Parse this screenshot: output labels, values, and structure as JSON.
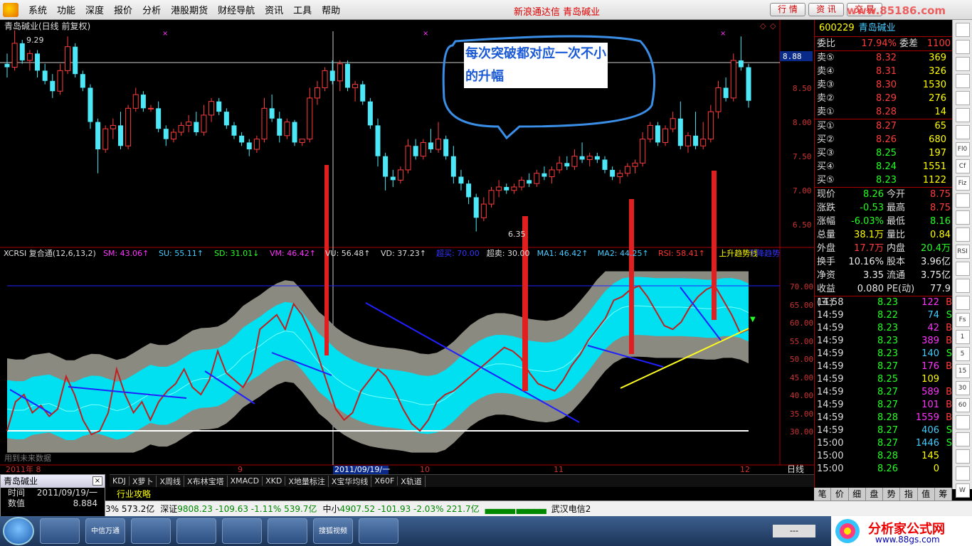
{
  "menu": {
    "items": [
      "系统",
      "功能",
      "深度",
      "报价",
      "分析",
      "港股期货",
      "财经导航",
      "资讯",
      "工具",
      "帮助"
    ],
    "app_title": "新浪通达信  青岛碱业",
    "buttons": [
      "行 情",
      "资 讯",
      "交 易"
    ],
    "watermark": "www.85186.com"
  },
  "chart": {
    "title": "青岛碱业(日线 前复权)",
    "high_label": "9.29",
    "low_label": "6.35",
    "current_price_tag": "8.88",
    "price_axis": [
      "8.50",
      "8.00",
      "7.50",
      "7.00",
      "6.50"
    ],
    "indicator_axis": [
      "70.00",
      "65.00",
      "60.00",
      "55.00",
      "50.00",
      "45.00",
      "40.00",
      "35.00",
      "30.00"
    ],
    "indicator_header": {
      "name": "XCRSI 复合通(12,6,13,2)",
      "items": [
        {
          "label": "SM: 43.06↑",
          "color": "#f3f"
        },
        {
          "label": "SU: 55.11↑",
          "color": "#4cf"
        },
        {
          "label": "SD: 31.01↓",
          "color": "#2f2"
        },
        {
          "label": "VM: 46.42↑",
          "color": "#f3f"
        },
        {
          "label": "VU: 56.48↑",
          "color": "#ddd"
        },
        {
          "label": "VD: 37.23↑",
          "color": "#ddd"
        },
        {
          "label": "超买: 70.00",
          "color": "#33f"
        },
        {
          "label": "超卖: 30.00",
          "color": "#ddd"
        },
        {
          "label": "MA1: 46.42↑",
          "color": "#4cf"
        },
        {
          "label": "MA2: 44.25↑",
          "color": "#4cf"
        },
        {
          "label": "RSI: 58.41↑",
          "color": "#f33"
        },
        {
          "label": "上升趋势线",
          "color": "#ff0"
        },
        {
          "label": "下降趋势",
          "color": "#33f"
        }
      ]
    },
    "future_data_note": "用到未来数据",
    "date_labels": {
      "m9": "9",
      "selected": "2011/09/19/一",
      "m10": "10",
      "m11": "11",
      "m12": "12",
      "left": "2011年 8",
      "period": "日线"
    },
    "callout": "每次突破都对应一次不小的升幅"
  },
  "quote": {
    "code": "600229",
    "name": "青岛碱业",
    "weibi_label": "委比",
    "weibi": "17.94%",
    "weicha_label": "委差",
    "weicha": "1100",
    "sells": [
      {
        "label": "卖⑤",
        "price": "8.32",
        "vol": "369"
      },
      {
        "label": "卖④",
        "price": "8.31",
        "vol": "326"
      },
      {
        "label": "卖③",
        "price": "8.30",
        "vol": "1530"
      },
      {
        "label": "卖②",
        "price": "8.29",
        "vol": "276"
      },
      {
        "label": "卖①",
        "price": "8.28",
        "vol": "14"
      }
    ],
    "buys": [
      {
        "label": "买①",
        "price": "8.27",
        "vol": "65"
      },
      {
        "label": "买②",
        "price": "8.26",
        "vol": "680"
      },
      {
        "label": "买③",
        "price": "8.25",
        "vol": "197"
      },
      {
        "label": "买④",
        "price": "8.24",
        "vol": "1551"
      },
      {
        "label": "买⑤",
        "price": "8.23",
        "vol": "1122"
      }
    ],
    "info": [
      {
        "a": "现价",
        "b": "8.26",
        "bc": "green",
        "c": "今开",
        "d": "8.75",
        "dc": "red"
      },
      {
        "a": "涨跌",
        "b": "-0.53",
        "bc": "green",
        "c": "最高",
        "d": "8.75",
        "dc": "red"
      },
      {
        "a": "涨幅",
        "b": "-6.03%",
        "bc": "green",
        "c": "最低",
        "d": "8.16",
        "dc": "green"
      },
      {
        "a": "总量",
        "b": "38.1万",
        "bc": "yellow",
        "c": "量比",
        "d": "0.84",
        "dc": "yellow"
      },
      {
        "a": "外盘",
        "b": "17.7万",
        "bc": "red",
        "c": "内盘",
        "d": "20.4万",
        "dc": "green"
      },
      {
        "a": "换手",
        "b": "10.16%",
        "bc": "white",
        "c": "股本",
        "d": "3.96亿",
        "dc": "white"
      },
      {
        "a": "净资",
        "b": "3.35",
        "bc": "white",
        "c": "流通",
        "d": "3.75亿",
        "dc": "white"
      },
      {
        "a": "收益(三)",
        "b": "0.080",
        "bc": "white",
        "c": "PE(动)",
        "d": "77.9",
        "dc": "white"
      }
    ],
    "ticks": [
      {
        "t": "14:58",
        "p": "8.23",
        "v": "122",
        "s": "B"
      },
      {
        "t": "14:59",
        "p": "8.22",
        "v": "74",
        "s": "S"
      },
      {
        "t": "14:59",
        "p": "8.23",
        "v": "42",
        "s": "B"
      },
      {
        "t": "14:59",
        "p": "8.23",
        "v": "389",
        "s": "B"
      },
      {
        "t": "14:59",
        "p": "8.23",
        "v": "140",
        "s": "S"
      },
      {
        "t": "14:59",
        "p": "8.27",
        "v": "176",
        "s": "B"
      },
      {
        "t": "14:59",
        "p": "8.25",
        "v": "109",
        "s": ""
      },
      {
        "t": "14:59",
        "p": "8.27",
        "v": "589",
        "s": "B"
      },
      {
        "t": "14:59",
        "p": "8.27",
        "v": "101",
        "s": "B"
      },
      {
        "t": "14:59",
        "p": "8.28",
        "v": "1559",
        "s": "B"
      },
      {
        "t": "14:59",
        "p": "8.27",
        "v": "406",
        "s": "S"
      },
      {
        "t": "15:00",
        "p": "8.27",
        "v": "1446",
        "s": "S"
      },
      {
        "t": "15:00",
        "p": "8.28",
        "v": "145",
        "s": ""
      },
      {
        "t": "15:00",
        "p": "8.26",
        "v": "0",
        "s": ""
      }
    ]
  },
  "toolstrip": [
    "",
    "",
    "",
    "",
    "",
    "",
    "",
    "Fl0",
    "Cf",
    "Fiz",
    "",
    "",
    "",
    "RSI",
    "",
    "",
    "",
    "Fs",
    "1",
    "5",
    "15",
    "30",
    "60",
    "",
    "",
    "",
    "",
    "W"
  ],
  "tabbar": [
    "KDJ",
    "X萝卜",
    "X周线",
    "X布林宝塔",
    "XMACD",
    "XKD",
    "X地量标注",
    "X宝华均线",
    "X60F",
    "X轨道"
  ],
  "subbar": "行业攻略",
  "panel_tabs": [
    "笔",
    "价",
    "细",
    "盘",
    "势",
    "指",
    "值",
    "筹"
  ],
  "mini": {
    "title": "青岛碱业",
    "rows": [
      {
        "k": "时间",
        "v": "2011/09/19/一"
      },
      {
        "k": "数值",
        "v": "8.884"
      }
    ]
  },
  "status": {
    "partial": "3%  573.2亿",
    "sz_label": "深证",
    "sz": "9808.23  -109.63  -1.11%  539.7亿",
    "zx_label": "中小",
    "zx": "4907.52  -101.93  -2.03%  221.7亿",
    "news": "武汉电信2"
  },
  "taskbar": {
    "buttons": [
      "中信万通",
      "",
      "",
      "",
      "",
      "搜狐视频",
      ""
    ],
    "brand_title": "分析家公式网",
    "brand_url": "www.88gs.com",
    "clock": "---"
  },
  "colors": {
    "up": "#ff3c3c",
    "down": "#4de8f8",
    "cyan_band": "#00e0f0",
    "gray_band": "#8a8a80",
    "rsi": "#c02020",
    "down_trend": "#2020ff",
    "up_trend": "#ffff20"
  },
  "chart_data": {
    "type": "candlestick",
    "price_range": [
      6.2,
      9.4
    ],
    "candles": [
      [
        8.8,
        8.95,
        8.6,
        8.75
      ],
      [
        8.75,
        9.29,
        8.7,
        9.1
      ],
      [
        9.1,
        9.15,
        8.8,
        8.85
      ],
      [
        8.85,
        9.0,
        8.7,
        8.95
      ],
      [
        8.95,
        9.0,
        8.6,
        8.7
      ],
      [
        8.7,
        8.8,
        8.5,
        8.55
      ],
      [
        8.55,
        8.65,
        8.3,
        8.4
      ],
      [
        8.4,
        8.8,
        8.35,
        8.7
      ],
      [
        8.7,
        9.2,
        8.65,
        9.05
      ],
      [
        9.05,
        9.1,
        8.6,
        8.65
      ],
      [
        8.65,
        8.7,
        8.4,
        8.45
      ],
      [
        8.45,
        8.5,
        7.85,
        7.95
      ],
      [
        7.95,
        8.0,
        7.2,
        7.55
      ],
      [
        7.55,
        7.9,
        7.5,
        7.85
      ],
      [
        7.85,
        8.0,
        7.7,
        7.9
      ],
      [
        7.9,
        8.1,
        7.55,
        7.6
      ],
      [
        7.6,
        8.2,
        7.55,
        8.15
      ],
      [
        8.15,
        8.45,
        8.1,
        8.35
      ],
      [
        8.35,
        8.4,
        8.1,
        8.15
      ],
      [
        8.15,
        8.2,
        8.1,
        8.15
      ],
      [
        8.15,
        8.25,
        7.8,
        7.85
      ],
      [
        7.85,
        7.9,
        7.6,
        7.7
      ],
      [
        7.7,
        7.85,
        7.65,
        7.8
      ],
      [
        7.8,
        7.95,
        7.75,
        7.9
      ],
      [
        7.9,
        8.05,
        7.8,
        7.95
      ],
      [
        7.95,
        8.1,
        7.75,
        7.8
      ],
      [
        7.8,
        8.2,
        7.75,
        8.05
      ],
      [
        8.05,
        8.3,
        7.95,
        8.25
      ],
      [
        8.25,
        8.3,
        8.05,
        8.1
      ],
      [
        8.1,
        8.15,
        7.85,
        7.9
      ],
      [
        7.9,
        7.95,
        7.7,
        7.75
      ],
      [
        7.75,
        7.8,
        7.6,
        7.65
      ],
      [
        7.65,
        7.7,
        7.45,
        7.55
      ],
      [
        7.55,
        7.75,
        7.5,
        7.7
      ],
      [
        7.7,
        8.3,
        7.65,
        8.15
      ],
      [
        8.15,
        8.35,
        7.95,
        8.0
      ],
      [
        8.0,
        8.1,
        7.65,
        7.75
      ],
      [
        7.75,
        8.0,
        7.7,
        7.95
      ],
      [
        7.95,
        7.98,
        7.6,
        7.65
      ],
      [
        7.65,
        7.7,
        7.6,
        7.7
      ],
      [
        7.7,
        8.45,
        7.65,
        8.3
      ],
      [
        8.3,
        8.55,
        8.2,
        8.45
      ],
      [
        8.45,
        8.75,
        8.4,
        8.7
      ],
      [
        8.7,
        8.85,
        8.5,
        8.55
      ],
      [
        8.55,
        8.85,
        8.4,
        8.8
      ],
      [
        8.8,
        8.85,
        8.4,
        8.45
      ],
      [
        8.45,
        8.55,
        8.25,
        8.5
      ],
      [
        8.5,
        8.55,
        8.2,
        8.25
      ],
      [
        8.25,
        8.3,
        7.85,
        7.9
      ],
      [
        7.9,
        8.0,
        7.3,
        7.45
      ],
      [
        7.45,
        7.5,
        6.95,
        7.15
      ],
      [
        7.15,
        7.25,
        7.0,
        7.1
      ],
      [
        7.1,
        7.3,
        7.05,
        7.25
      ],
      [
        7.25,
        7.7,
        7.2,
        7.6
      ],
      [
        7.6,
        7.7,
        7.4,
        7.45
      ],
      [
        7.45,
        7.7,
        7.4,
        7.65
      ],
      [
        7.65,
        7.85,
        7.5,
        7.55
      ],
      [
        7.55,
        7.95,
        7.5,
        7.7
      ],
      [
        7.7,
        7.75,
        7.4,
        7.45
      ],
      [
        7.45,
        7.6,
        7.05,
        7.15
      ],
      [
        7.15,
        7.25,
        6.95,
        7.05
      ],
      [
        7.05,
        7.1,
        6.75,
        6.85
      ],
      [
        6.85,
        6.9,
        6.35,
        6.55
      ],
      [
        6.55,
        6.85,
        6.5,
        6.75
      ],
      [
        6.75,
        7.0,
        6.7,
        6.95
      ],
      [
        6.95,
        7.1,
        6.85,
        7.0
      ],
      [
        7.0,
        7.05,
        6.9,
        6.95
      ],
      [
        6.95,
        7.05,
        6.9,
        7.0
      ],
      [
        7.0,
        7.15,
        6.95,
        7.1
      ],
      [
        7.1,
        7.2,
        7.0,
        7.05
      ],
      [
        7.05,
        7.25,
        7.0,
        7.2
      ],
      [
        7.2,
        7.3,
        7.1,
        7.15
      ],
      [
        7.15,
        7.3,
        7.05,
        7.25
      ],
      [
        7.25,
        7.45,
        7.2,
        7.35
      ],
      [
        7.35,
        7.45,
        7.25,
        7.3
      ],
      [
        7.3,
        7.55,
        7.25,
        7.45
      ],
      [
        7.45,
        7.65,
        7.35,
        7.4
      ],
      [
        7.4,
        7.5,
        7.3,
        7.45
      ],
      [
        7.45,
        7.5,
        7.35,
        7.4
      ],
      [
        7.4,
        7.45,
        7.2,
        7.25
      ],
      [
        7.25,
        7.3,
        7.1,
        7.15
      ],
      [
        7.15,
        7.25,
        7.05,
        7.2
      ],
      [
        7.2,
        7.35,
        7.15,
        7.3
      ],
      [
        7.3,
        7.4,
        7.2,
        7.35
      ],
      [
        7.35,
        7.8,
        7.3,
        7.7
      ],
      [
        7.7,
        7.95,
        7.65,
        7.9
      ],
      [
        7.9,
        7.95,
        7.6,
        7.65
      ],
      [
        7.65,
        7.9,
        7.6,
        7.85
      ],
      [
        7.85,
        8.1,
        7.8,
        8.0
      ],
      [
        8.0,
        8.25,
        7.55,
        7.6
      ],
      [
        7.6,
        7.8,
        7.5,
        7.75
      ],
      [
        7.75,
        8.1,
        7.55,
        7.6
      ],
      [
        7.6,
        7.95,
        7.55,
        7.7
      ],
      [
        7.7,
        8.2,
        7.65,
        8.1
      ],
      [
        8.1,
        8.55,
        8.0,
        8.45
      ],
      [
        8.45,
        8.6,
        8.25,
        8.3
      ],
      [
        8.3,
        8.95,
        8.25,
        8.85
      ],
      [
        8.85,
        9.2,
        8.7,
        8.75
      ],
      [
        8.75,
        8.8,
        8.16,
        8.26
      ]
    ],
    "rsi": [
      30,
      38,
      40,
      35,
      37,
      34,
      36,
      45,
      40,
      33,
      29,
      30,
      35,
      47,
      40,
      35,
      38,
      33,
      38,
      41,
      43,
      47,
      42,
      40,
      44,
      52,
      46,
      44,
      42,
      46,
      58,
      60,
      62,
      58,
      65,
      62,
      57,
      50,
      43,
      36,
      33,
      35,
      41,
      44,
      47,
      45,
      41,
      36,
      32,
      30,
      33,
      38,
      40,
      41,
      43,
      45,
      47,
      49,
      51,
      53,
      52,
      50,
      46,
      43,
      42,
      41,
      44,
      48,
      51,
      55,
      58,
      61,
      66,
      67,
      69,
      70,
      67,
      63,
      59,
      58,
      60,
      64,
      67,
      69,
      70,
      66,
      62,
      57,
      58
    ],
    "overbought": 70,
    "oversold": 30
  }
}
